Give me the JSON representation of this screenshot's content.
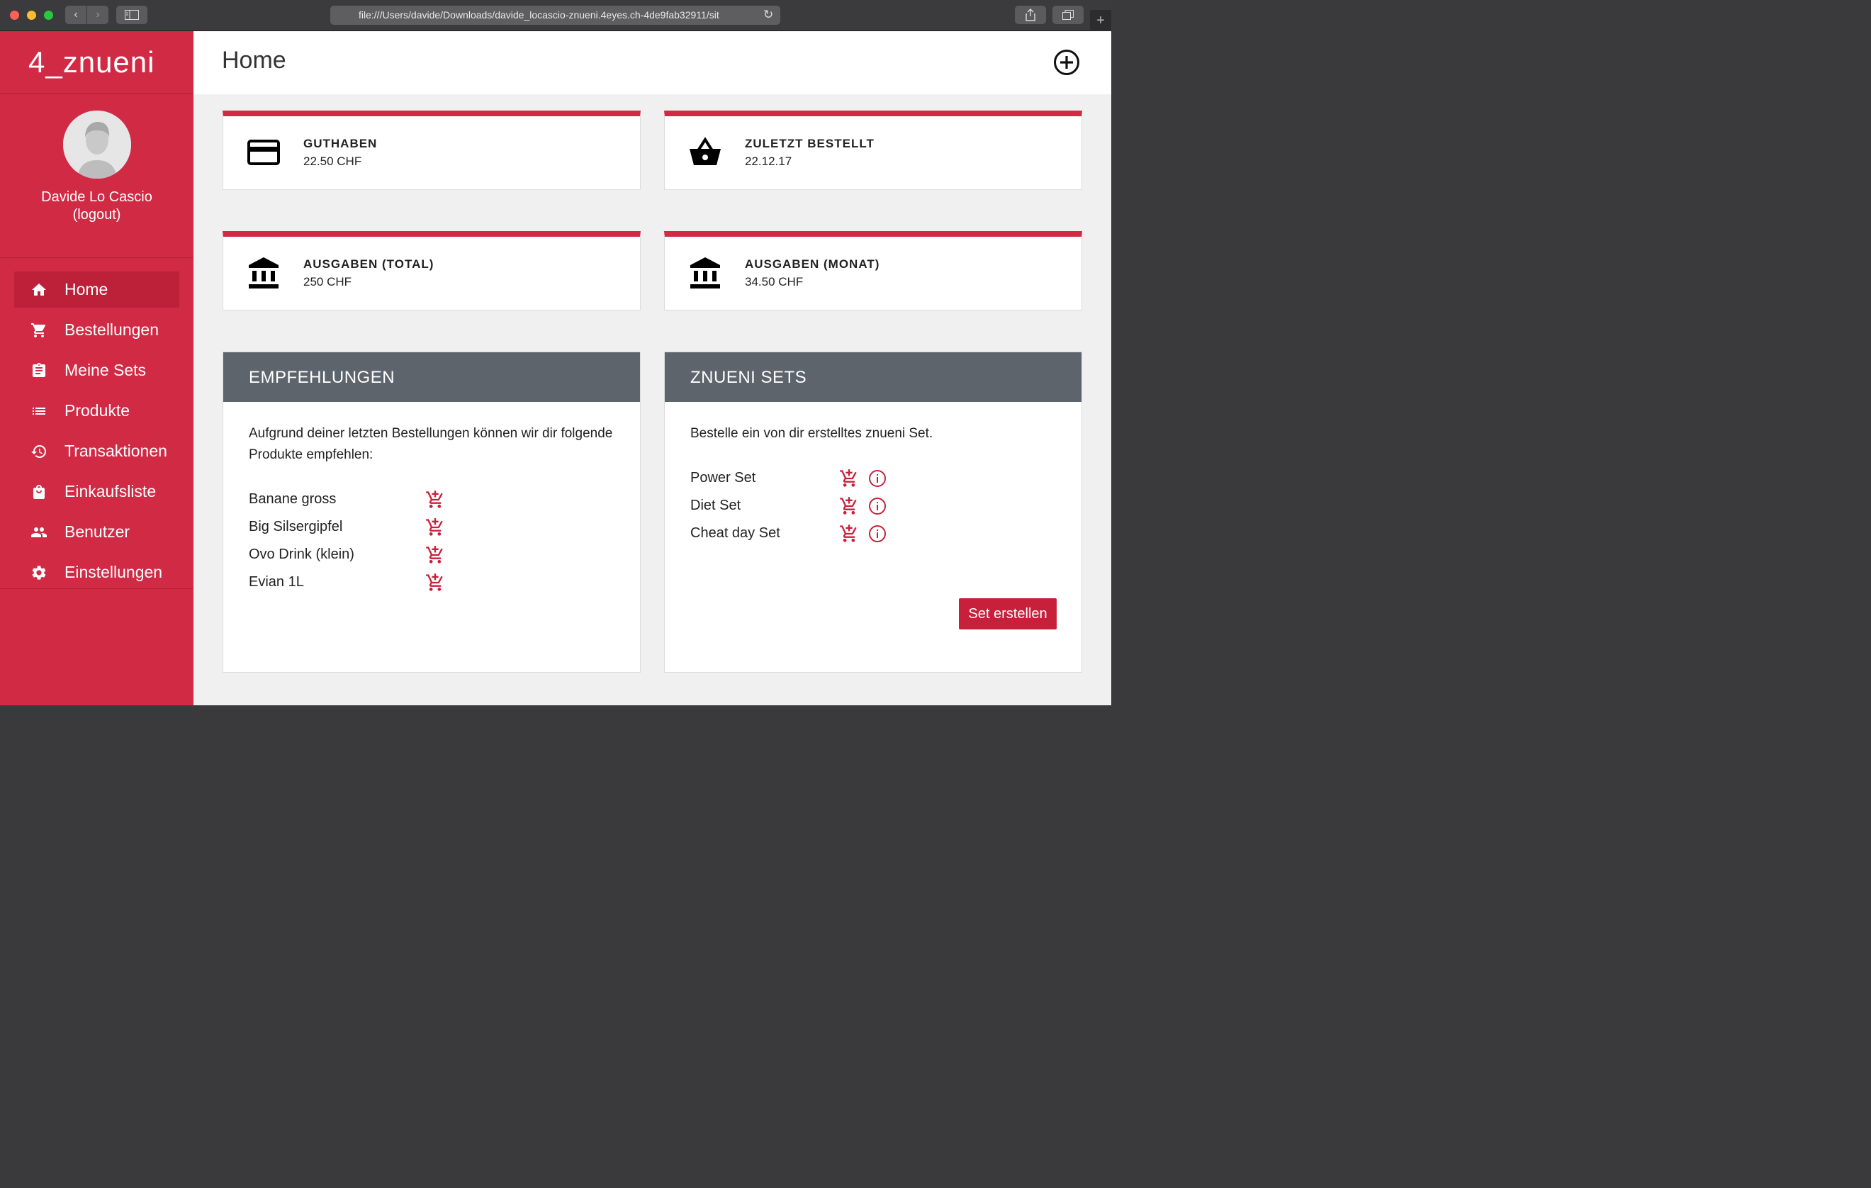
{
  "browser": {
    "url": "file:///Users/davide/Downloads/davide_locascio-znueni.4eyes.ch-4de9fab32911/sit"
  },
  "sidebar": {
    "brand": "4_znueni",
    "user_name": "Davide Lo Cascio",
    "logout_label": "(logout)",
    "items": [
      {
        "label": "Home",
        "icon": "home-icon",
        "active": true
      },
      {
        "label": "Bestellungen",
        "icon": "cart-icon"
      },
      {
        "label": "Meine Sets",
        "icon": "clipboard-icon"
      },
      {
        "label": "Produkte",
        "icon": "list-icon"
      },
      {
        "label": "Transaktionen",
        "icon": "history-icon"
      },
      {
        "label": "Einkaufsliste",
        "icon": "shopping-bag-icon"
      },
      {
        "label": "Benutzer",
        "icon": "people-icon"
      },
      {
        "label": "Einstellungen",
        "icon": "gear-icon"
      }
    ]
  },
  "header": {
    "title": "Home"
  },
  "stats": [
    {
      "title": "GUTHABEN",
      "value": "22.50 CHF",
      "icon": "credit-card-icon"
    },
    {
      "title": "ZULETZT BESTELLT",
      "value": "22.12.17",
      "icon": "basket-icon"
    },
    {
      "title": "AUSGABEN (TOTAL)",
      "value": "250 CHF",
      "icon": "bank-icon"
    },
    {
      "title": "AUSGABEN (MONAT)",
      "value": "34.50 CHF",
      "icon": "bank-icon"
    }
  ],
  "recommendations": {
    "title": "EMPFEHLUNGEN",
    "description": "Aufgrund deiner letzten Bestellungen können wir dir folgende Produkte empfehlen:",
    "items": [
      "Banane gross",
      "Big Silsergipfel",
      "Ovo Drink (klein)",
      "Evian 1L"
    ]
  },
  "sets": {
    "title": "ZNUENI SETS",
    "description": "Bestelle ein von dir erstelltes znueni Set.",
    "items": [
      "Power Set",
      "Diet Set",
      "Cheat day Set"
    ],
    "create_label": "Set erstellen"
  },
  "colors": {
    "brand": "#d12a45",
    "panel_header": "#5e646c",
    "button": "#c8203b"
  }
}
